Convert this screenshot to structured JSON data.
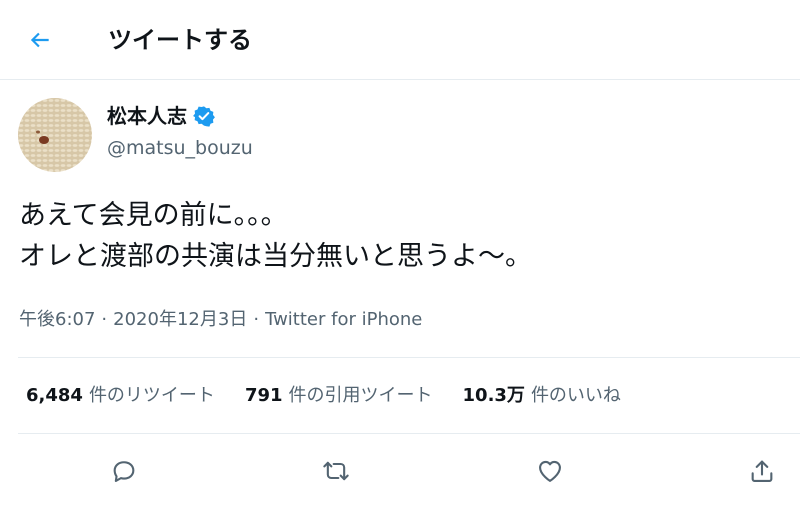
{
  "header": {
    "title": "ツイートする",
    "back_icon": "back-arrow-icon"
  },
  "colors": {
    "accent": "#1d9bf0",
    "text": "#0f1419",
    "secondary": "#536471",
    "divider": "#e6ecf0"
  },
  "tweet": {
    "author": {
      "display_name": "松本人志",
      "handle": "@matsu_bouzu",
      "verified": true
    },
    "text_lines": [
      "あえて会見の前に。。。",
      "オレと渡部の共演は当分無いと思うよ〜。"
    ],
    "meta": {
      "time": "午後6:07",
      "separator": "·",
      "date": "2020年12月3日",
      "source": "Twitter for iPhone"
    },
    "stats": {
      "retweets": {
        "count": "6,484",
        "label": "件のリツイート"
      },
      "quotes": {
        "count": "791",
        "label": "件の引用ツイート"
      },
      "likes": {
        "count": "10.3万",
        "label": "件のいいね"
      }
    }
  },
  "actions": [
    {
      "icon": "reply-icon"
    },
    {
      "icon": "retweet-icon"
    },
    {
      "icon": "like-icon"
    },
    {
      "icon": "share-icon"
    }
  ]
}
